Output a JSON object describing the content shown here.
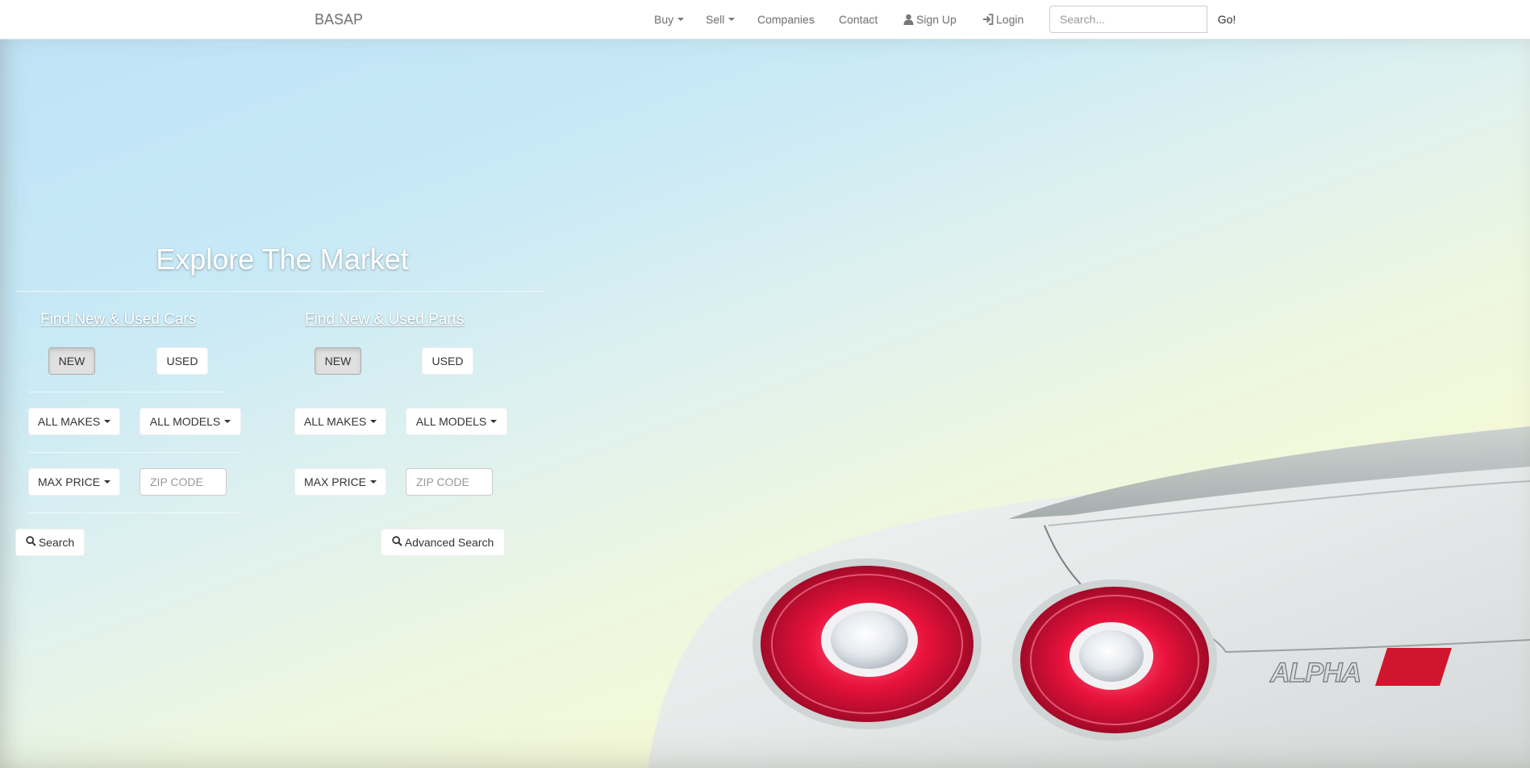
{
  "navbar": {
    "brand": "BASAP",
    "items": [
      {
        "label": "Buy",
        "dropdown": true
      },
      {
        "label": "Sell",
        "dropdown": true
      },
      {
        "label": "Companies"
      },
      {
        "label": "Contact"
      },
      {
        "label": "Sign Up",
        "icon": "user-icon"
      },
      {
        "label": "Login",
        "icon": "log-in-icon"
      }
    ],
    "search": {
      "placeholder": "Search...",
      "value": "",
      "button_label": "Go!"
    }
  },
  "hero": {
    "title": "Explore The Market",
    "cars": {
      "heading": "Find New & Used Cars",
      "condition": {
        "new_label": "NEW",
        "used_label": "USED",
        "selected": "NEW"
      },
      "makes_label": "ALL MAKES",
      "models_label": "ALL MODELS",
      "max_price_label": "MAX PRICE",
      "zip_placeholder": "ZIP CODE",
      "search_label": "Search"
    },
    "parts": {
      "heading": "Find New & Used Parts",
      "condition": {
        "new_label": "NEW",
        "used_label": "USED",
        "selected": "NEW"
      },
      "makes_label": "ALL MAKES",
      "models_label": "ALL MODELS",
      "max_price_label": "MAX PRICE",
      "zip_placeholder": "ZIP CODE",
      "advanced_search_label": "Advanced Search"
    }
  },
  "colors": {
    "background_sky": "#c8e9f6",
    "taillight_red": "#e8123c",
    "car_body": "#e9ecec"
  },
  "background_image": {
    "emblem_text": "ALPHA"
  }
}
